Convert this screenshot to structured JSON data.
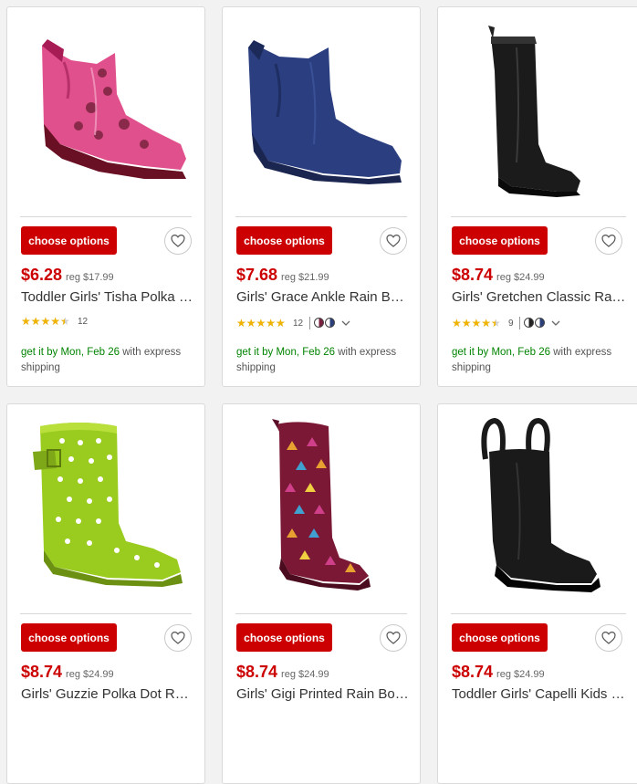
{
  "products": [
    {
      "title": "Toddler Girls' Tisha Polka Dot Rain Boots",
      "price": "$6.28",
      "reg": "reg $17.99",
      "rating": 4.0,
      "review_count": "12",
      "swatches": [],
      "button_label": "choose options",
      "delivery_prefix": "get it by Mon, Feb 26",
      "delivery_suffix": " with express shipping",
      "boot_color": "#e0508c"
    },
    {
      "title": "Girls' Grace Ankle Rain Boots",
      "price": "$7.68",
      "reg": "reg $21.99",
      "rating": 4.5,
      "review_count": "12",
      "swatches": [
        "#7a1f3d",
        "#2a3f7a"
      ],
      "button_label": "choose options",
      "delivery_prefix": "get it by Mon, Feb 26",
      "delivery_suffix": " with express shipping",
      "boot_color": "#2b3f80"
    },
    {
      "title": "Girls' Gretchen Classic Rain Boots",
      "price": "$8.74",
      "reg": "reg $24.99",
      "rating": 4.0,
      "review_count": "9",
      "swatches": [
        "#222222",
        "#2a3f7a"
      ],
      "button_label": "choose options",
      "delivery_prefix": "get it by Mon, Feb 26",
      "delivery_suffix": " with express shipping",
      "boot_color": "#1b1b1b"
    },
    {
      "title": "Girls' Guzzie Polka Dot Rain Boots",
      "price": "$8.74",
      "reg": "reg $24.99",
      "button_label": "choose options",
      "boot_color": "#9acc20"
    },
    {
      "title": "Girls' Gigi Printed Rain Boots",
      "price": "$8.74",
      "reg": "reg $24.99",
      "button_label": "choose options",
      "boot_color": "#7a1835"
    },
    {
      "title": "Toddler Girls' Capelli Kids Rain Boots",
      "price": "$8.74",
      "reg": "reg $24.99",
      "button_label": "choose options",
      "boot_color": "#1a1a1a"
    }
  ],
  "colors": {
    "accent": "#cc0000",
    "delivery_green": "#008300",
    "star": "#f0b400"
  },
  "icons": {
    "favorite": "heart-outline-icon",
    "star": "star-icon",
    "expand": "chevron-down-icon"
  }
}
